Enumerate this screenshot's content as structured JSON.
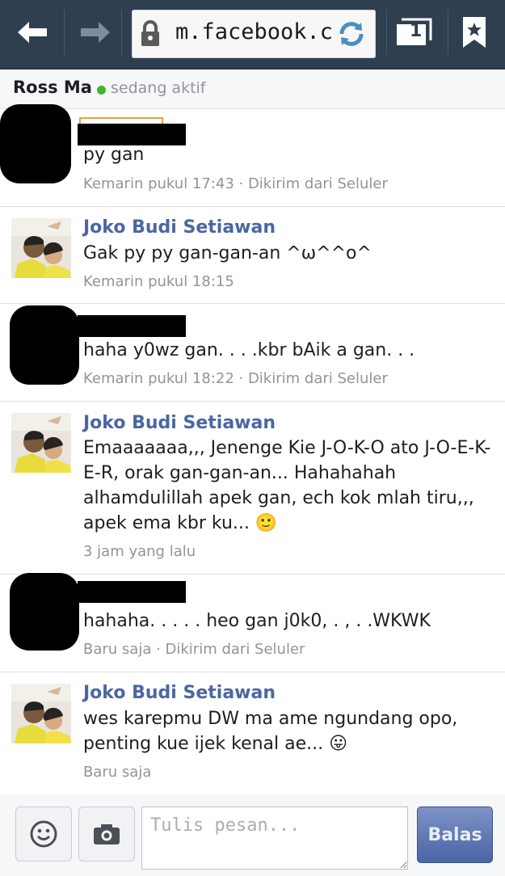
{
  "browser": {
    "url": "m.facebook.co",
    "tab_count": "1"
  },
  "chat": {
    "contact_name": "Ross Ma",
    "status": "sedang aktif"
  },
  "messages": [
    {
      "sender": "",
      "text": "py gan",
      "meta": "Kemarin pukul 17:43 · Dikirim dari Seluler",
      "redacted": true
    },
    {
      "sender": "Joko Budi Setiawan",
      "text": "Gak py py gan-gan-an ^ω^^o^",
      "meta": "Kemarin pukul 18:15",
      "redacted": false
    },
    {
      "sender": "",
      "text": "haha y0wz gan. . . .kbr bAik a gan. . .",
      "meta": "Kemarin pukul 18:22 · Dikirim dari Seluler",
      "redacted": true
    },
    {
      "sender": "Joko Budi Setiawan",
      "text": "Emaaaaaaa,,, Jenenge Kie J-O-K-O ato J-O-E-K-E-R, orak gan-gan-an... Hahahahah alhamdulillah apek gan, ech kok mlah tiru,,, apek ema kbr ku... 🙂",
      "meta": "3 jam yang lalu",
      "redacted": false
    },
    {
      "sender": "",
      "text": "hahaha. . . . . heo gan j0k0, . , . .WKWK",
      "meta": "Baru saja · Dikirim dari Seluler",
      "redacted": true
    },
    {
      "sender": "Joko Budi Setiawan",
      "text": "wes karepmu DW ma ame ngundang opo, penting kue ijek kenal ae... 😛",
      "meta": "Baru saja",
      "redacted": false
    }
  ],
  "composer": {
    "placeholder": "Tulis pesan...",
    "send_label": "Balas"
  },
  "colors": {
    "browser_bar": "#2f3f50",
    "link_blue": "#4b67a1",
    "online_green": "#42b72a",
    "meta_gray": "#90949c"
  }
}
